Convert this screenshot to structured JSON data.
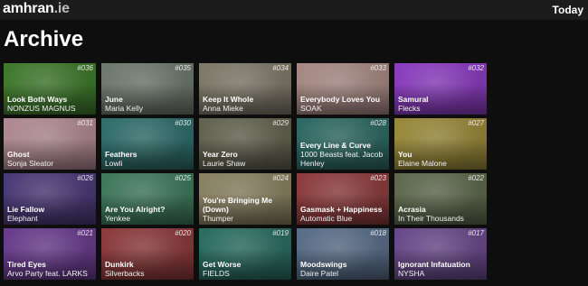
{
  "header": {
    "brand_main": "amhran",
    "brand_suffix": ".ie",
    "today_label": "Today"
  },
  "page": {
    "title": "Archive"
  },
  "tiles": [
    {
      "number": "#036",
      "title": "Look Both Ways",
      "artist": "NONZUS MAGNUS",
      "color": "#3f7a2c"
    },
    {
      "number": "#035",
      "title": "June",
      "artist": "Maria Kelly",
      "color": "#6f7a6e"
    },
    {
      "number": "#034",
      "title": "Keep It Whole",
      "artist": "Anna Mieke",
      "color": "#7f7a6a"
    },
    {
      "number": "#033",
      "title": "Everybody Loves You",
      "artist": "SOAK",
      "color": "#a88a84"
    },
    {
      "number": "#032",
      "title": "Samural",
      "artist": "Flecks",
      "color": "#8b3cc0"
    },
    {
      "number": "#031",
      "title": "Ghost",
      "artist": "Sonja Sleator",
      "color": "#b18a93"
    },
    {
      "number": "#030",
      "title": "Feathers",
      "artist": "Lowli",
      "color": "#2f6f6c"
    },
    {
      "number": "#029",
      "title": "Year Zero",
      "artist": "Laurie Shaw",
      "color": "#636450"
    },
    {
      "number": "#028",
      "title": "Every Line & Curve",
      "artist": "1000 Beasts feat. Jacob Henley",
      "color": "#2e6a64"
    },
    {
      "number": "#027",
      "title": "You",
      "artist": "Elaine Malone",
      "color": "#9a8a3a"
    },
    {
      "number": "#026",
      "title": "Lie Fallow",
      "artist": "Elephant",
      "color": "#4b3a78"
    },
    {
      "number": "#025",
      "title": "Are You Alright?",
      "artist": "Yenkee",
      "color": "#3f7a5c"
    },
    {
      "number": "#024",
      "title": "You're Bringing Me (Down)",
      "artist": "Thumper",
      "color": "#8a8262"
    },
    {
      "number": "#023",
      "title": "Gasmask + Happiness",
      "artist": "Automatic Blue",
      "color": "#8e3c3e"
    },
    {
      "number": "#022",
      "title": "Acrasia",
      "artist": "In Their Thousands",
      "color": "#5f6a4e"
    },
    {
      "number": "#021",
      "title": "Tired Eyes",
      "artist": "Arvo Party feat. LARKS",
      "color": "#6a3c8e"
    },
    {
      "number": "#020",
      "title": "Dunkirk",
      "artist": "Silverbacks",
      "color": "#8e3a3c"
    },
    {
      "number": "#019",
      "title": "Get Worse",
      "artist": "FIELDS",
      "color": "#2a6e62"
    },
    {
      "number": "#018",
      "title": "Moodswings",
      "artist": "Daire Patel",
      "color": "#5a6e8a"
    },
    {
      "number": "#017",
      "title": "Ignorant Infatuation",
      "artist": "NYSHA",
      "color": "#6a4a8c"
    }
  ]
}
